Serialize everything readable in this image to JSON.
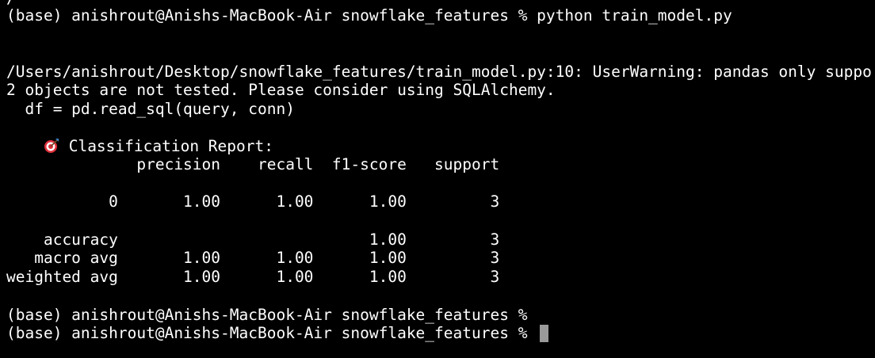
{
  "terminal": {
    "top_cutoff": "/                                                  ",
    "command_line": "(base) anishrout@Anishs-MacBook-Air snowflake_features % python train_model.py",
    "warning_line_1": "/Users/anishrout/Desktop/snowflake_features/train_model.py:10: UserWarning: pandas only suppo",
    "warning_line_2": "2 objects are not tested. Please consider using SQLAlchemy.",
    "warning_line_3": "  df = pd.read_sql(query, conn)",
    "report_icon": "target-icon",
    "report_title": " Classification Report:",
    "table_header": "              precision    recall  f1-score   support",
    "row_0": "           0       1.00      1.00      1.00         3",
    "row_accuracy": "    accuracy                           1.00         3",
    "row_macro_avg": "   macro avg       1.00      1.00      1.00         3",
    "row_weighted_avg": "weighted avg       1.00      1.00      1.00         3",
    "prompt_1": "(base) anishrout@Anishs-MacBook-Air snowflake_features %",
    "prompt_2": "(base) anishrout@Anishs-MacBook-Air snowflake_features % "
  },
  "colors": {
    "background": "#000000",
    "text": "#ffffff",
    "cursor": "#9a9a9a"
  }
}
